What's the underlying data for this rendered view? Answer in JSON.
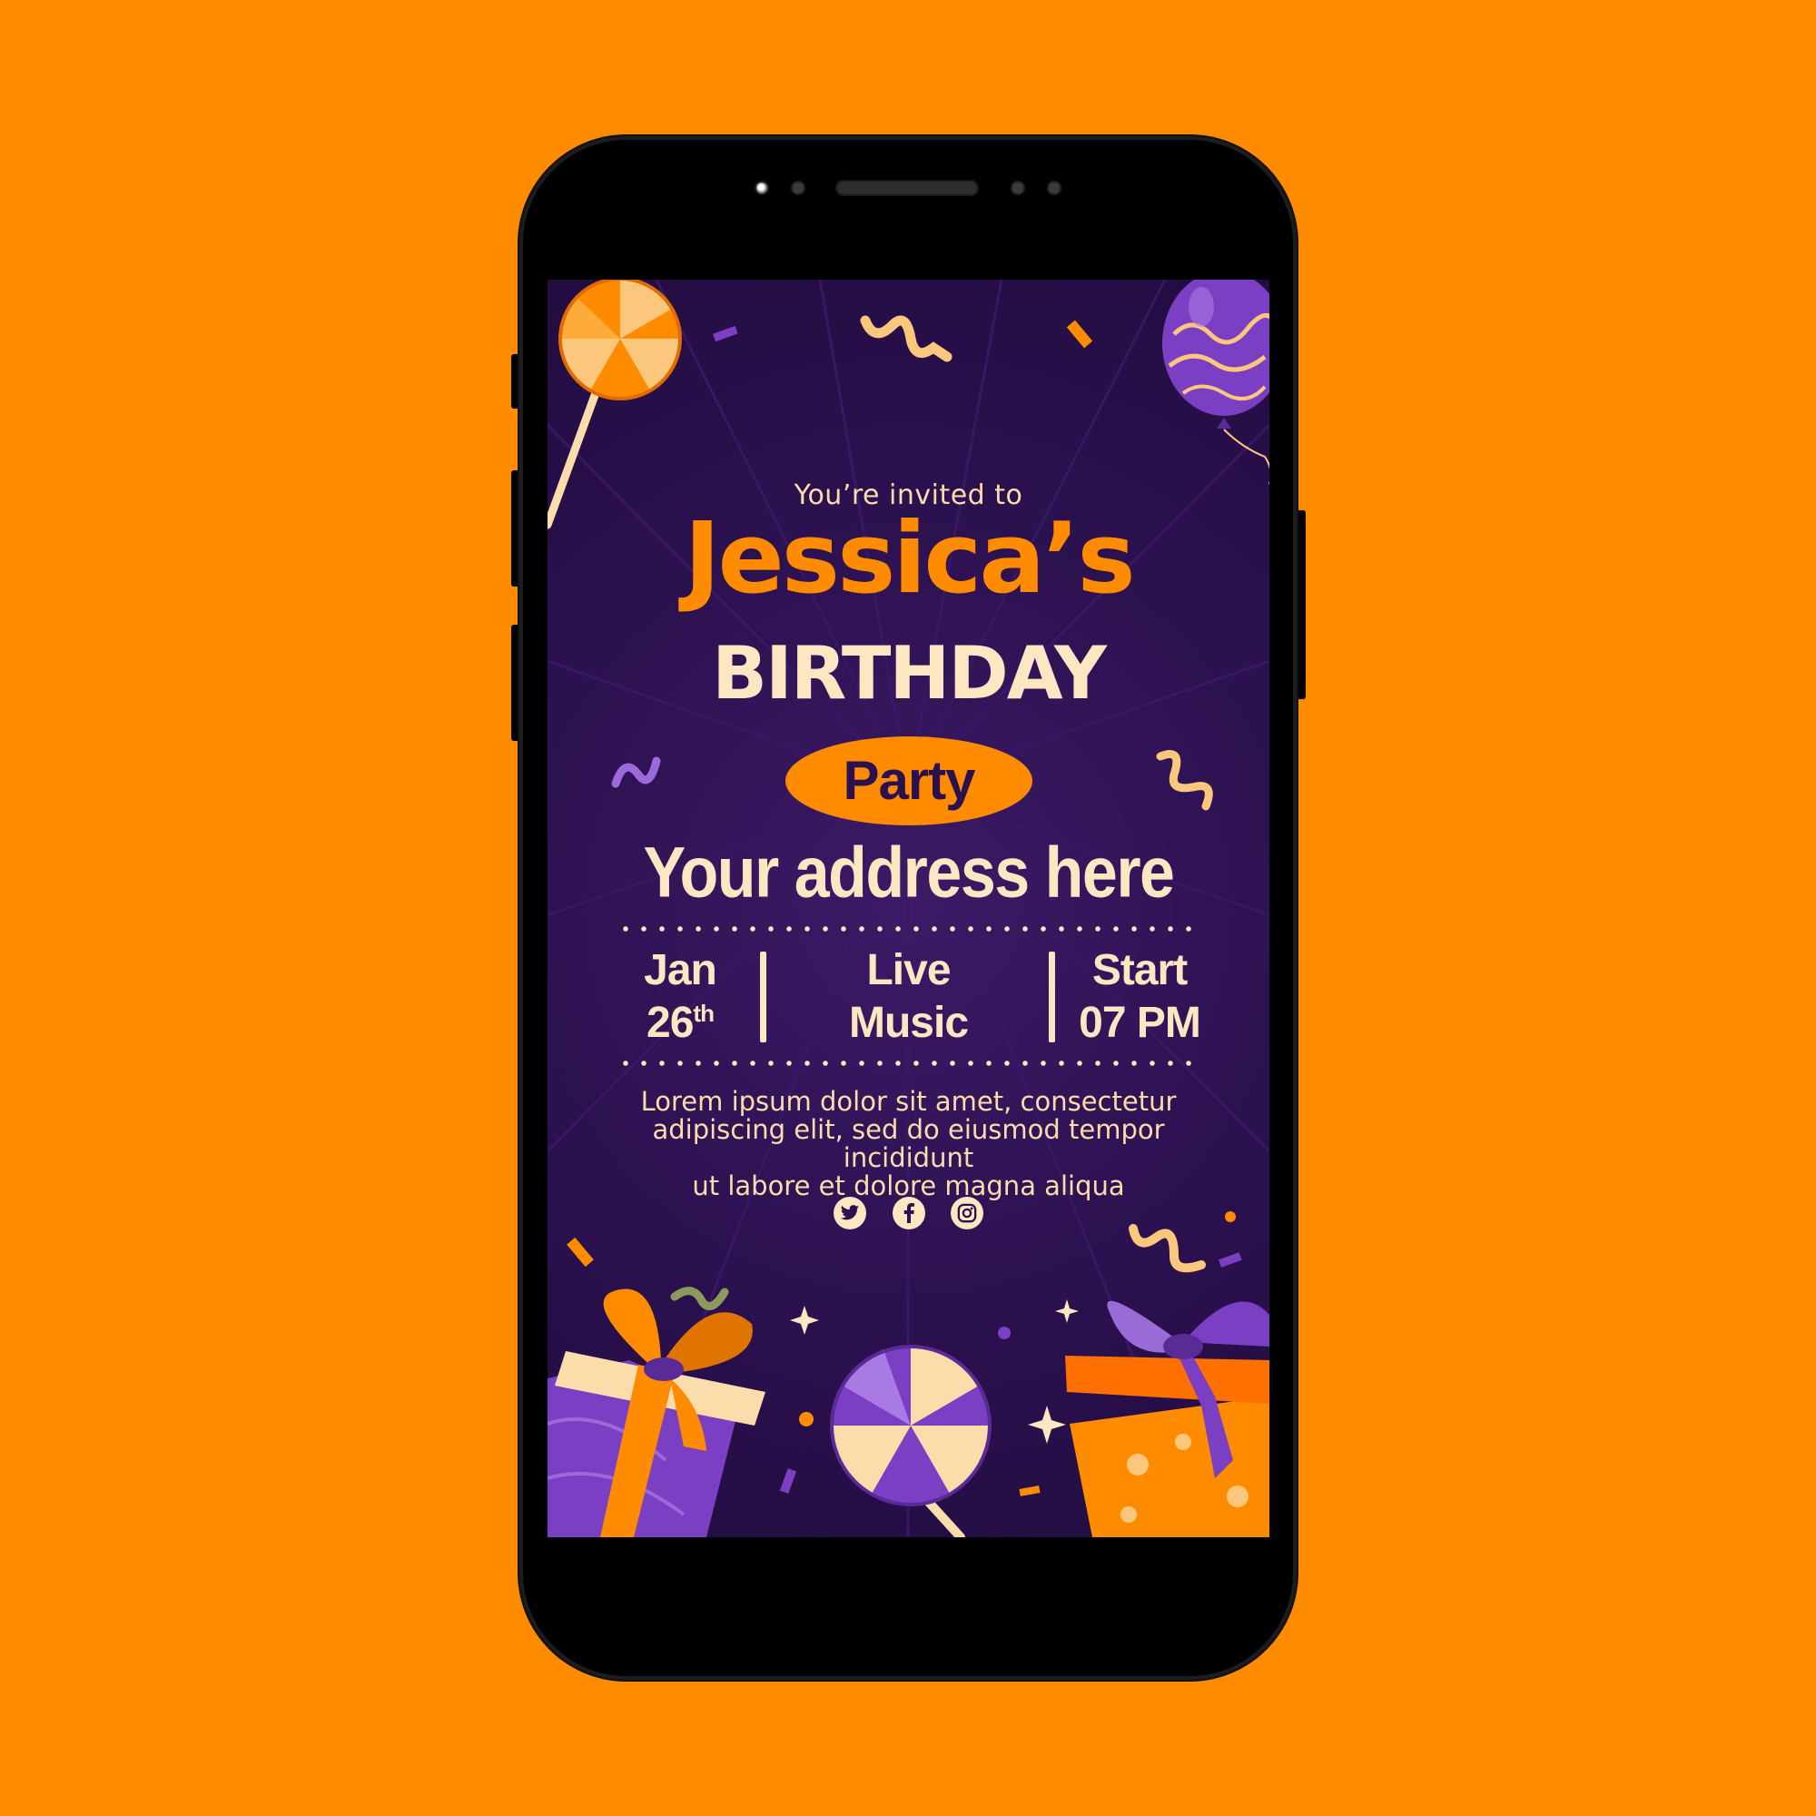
{
  "invitation": {
    "intro": "You’re invited to",
    "name": "Jessica’s",
    "occasion": "BIRTHDAY",
    "event_type": "Party",
    "address": "Your address here",
    "date_month": "Jan",
    "date_day": "26",
    "date_suffix": "th",
    "feature_line1": "Live",
    "feature_line2": "Music",
    "start_label": "Start",
    "start_time": "07 PM",
    "description_line1": "Lorem ipsum dolor sit amet, consectetur",
    "description_line2": "adipiscing elit, sed do eiusmod tempor incididunt",
    "description_line3": "ut labore et dolore magna aliqua"
  },
  "social_icons": [
    "twitter-icon",
    "facebook-icon",
    "instagram-icon"
  ],
  "colors": {
    "background": "#ff8c00",
    "screen": "#2c1150",
    "accent_orange": "#ff8c00",
    "cream_text": "#fde7c2",
    "purple": "#7b3fc4"
  }
}
